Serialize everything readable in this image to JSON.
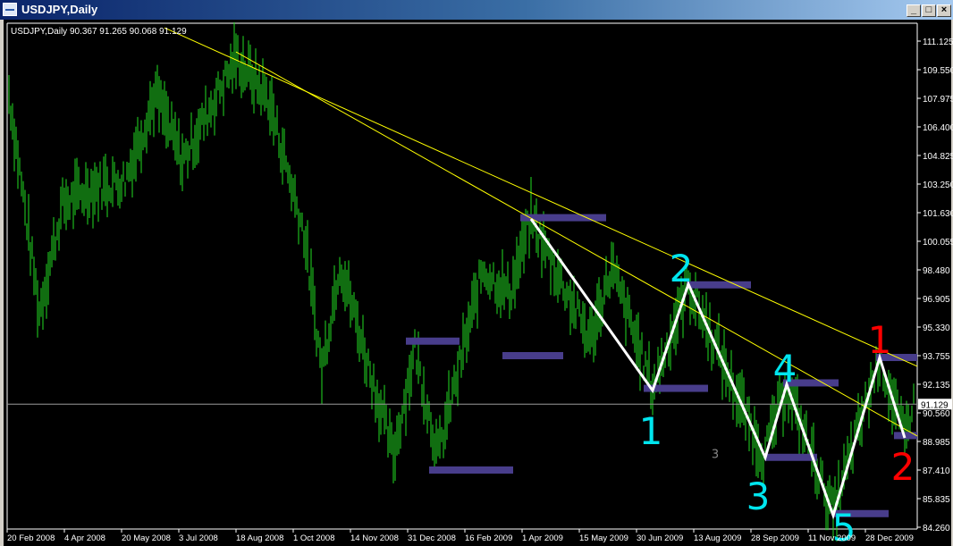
{
  "window": {
    "title": "USDJPY,Daily",
    "buttons": [
      "_",
      "□",
      "×"
    ]
  },
  "chart_info": "USDJPY,Daily  90.367 91.265 90.068 91.129",
  "current_price": "91.129",
  "colors": {
    "bars": "#22dd22",
    "trendline": "#ffff00",
    "zone": "#483d8b",
    "zigzag": "#ffffff",
    "wave_cyan": "#00e5ee",
    "wave_red": "#ff0000"
  },
  "chart_data": {
    "type": "bar",
    "symbol": "USDJPY",
    "timeframe": "Daily",
    "y_ticks": [
      "111.125",
      "109.550",
      "107.975",
      "106.400",
      "104.825",
      "103.250",
      "101.630",
      "100.055",
      "98.480",
      "96.905",
      "95.330",
      "93.755",
      "92.135",
      "90.560",
      "88.985",
      "87.410",
      "85.835",
      "84.260"
    ],
    "x_ticks": [
      "20 Feb 2008",
      "4 Apr 2008",
      "20 May 2008",
      "3 Jul 2008",
      "18 Aug 2008",
      "1 Oct 2008",
      "14 Nov 2008",
      "31 Dec 2008",
      "16 Feb 2009",
      "1 Apr 2009",
      "15 May 2009",
      "30 Jun 2009",
      "13 Aug 2009",
      "28 Sep 2009",
      "11 Nov 2009",
      "28 Dec 2009"
    ],
    "ylim": [
      84.26,
      111.125
    ],
    "price_path": [
      [
        1,
        108.2
      ],
      [
        18,
        96.2
      ],
      [
        31,
        102.1
      ],
      [
        46,
        103
      ],
      [
        66,
        103.5
      ],
      [
        83,
        108.2
      ],
      [
        98,
        104.5
      ],
      [
        128,
        110.2
      ],
      [
        146,
        108
      ],
      [
        166,
        100.6
      ],
      [
        176,
        93
      ],
      [
        186,
        99
      ],
      [
        216,
        88.3
      ],
      [
        228,
        94.2
      ],
      [
        241,
        88.3
      ],
      [
        266,
        98.6
      ],
      [
        281,
        97.2
      ],
      [
        293,
        101.3
      ],
      [
        326,
        94.7
      ],
      [
        338,
        98.6
      ],
      [
        361,
        92.0
      ],
      [
        381,
        97.8
      ],
      [
        423,
        88.3
      ],
      [
        436,
        92.2
      ],
      [
        462,
        85.1
      ],
      [
        488,
        93.7
      ],
      [
        502,
        89.2
      ],
      [
        506,
        91.1
      ]
    ],
    "zigzag": [
      [
        293,
        101.33
      ],
      [
        361,
        91.88
      ],
      [
        381,
        97.74
      ],
      [
        424,
        88.19
      ],
      [
        436,
        92.22
      ],
      [
        462,
        85.0
      ],
      [
        488,
        93.7
      ],
      [
        502,
        89.27
      ]
    ],
    "zones": [
      [
        223,
        253,
        94.6
      ],
      [
        236,
        283,
        87.5
      ],
      [
        277,
        311,
        93.8
      ],
      [
        287,
        335,
        101.4
      ],
      [
        356,
        392,
        92.0
      ],
      [
        380,
        416,
        97.7
      ],
      [
        424,
        453,
        88.2
      ],
      [
        434,
        465,
        92.3
      ],
      [
        462,
        493,
        85.1
      ],
      [
        486,
        509,
        93.7
      ],
      [
        496,
        509,
        89.4
      ]
    ],
    "trendlines": [
      [
        [
          88,
          111.86
        ],
        [
          509,
          93.21
        ]
      ],
      [
        [
          128,
          110.53
        ],
        [
          509,
          89.37
        ]
      ]
    ],
    "wave_labels": [
      {
        "text": "1",
        "color": "cyan",
        "bar": 360,
        "price": 89.66
      },
      {
        "text": "2",
        "color": "cyan",
        "bar": 377,
        "price": 98.62
      },
      {
        "text": "3",
        "color": "cyan",
        "bar": 420,
        "price": 86.07
      },
      {
        "text": "4",
        "color": "cyan",
        "bar": 435,
        "price": 93.1
      },
      {
        "text": "5",
        "color": "cyan",
        "bar": 468,
        "price": 84.35
      },
      {
        "text": "1",
        "color": "red",
        "bar": 488,
        "price": 94.68
      },
      {
        "text": "2",
        "color": "red",
        "bar": 501,
        "price": 87.69
      },
      {
        "text": "3",
        "color": "gray",
        "bar": 396,
        "price": 88.41
      }
    ]
  }
}
